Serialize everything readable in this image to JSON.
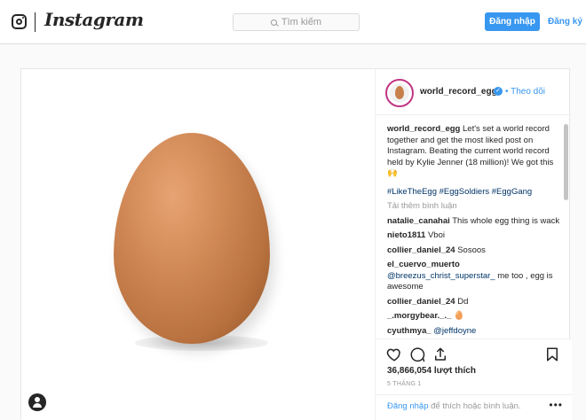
{
  "header": {
    "wordmark": "Instagram",
    "search_placeholder": "Tìm kiếm",
    "login_label": "Đăng nhập",
    "signup_label": "Đăng ký"
  },
  "post": {
    "username": "world_record_egg",
    "follow_label": "Theo dõi",
    "caption_user": "world_record_egg",
    "caption_text": "Let's set a world record together and get the most liked post on Instagram. Beating the current world record held by Kylie Jenner (18 million)! We got this 🙌",
    "hashtags": "#LikeTheEgg #EggSoldiers #EggGang",
    "load_more": "Tải thêm bình luận",
    "comments": [
      {
        "user": "natalie_canahai",
        "text": "This whole egg thing is wack"
      },
      {
        "user": "nieto1811",
        "text": "Vboi"
      },
      {
        "user": "collier_daniel_24",
        "text": "Sosoos"
      },
      {
        "user": "el_cuervo_muerto",
        "mention": "@breezus_christ_superstar_",
        "text": " me too , egg is awesome"
      },
      {
        "user": "collier_daniel_24",
        "text": "Dd"
      },
      {
        "user": "_.morgybear._._",
        "text": "🥚"
      },
      {
        "user": "cyuthmya_",
        "mention": "@jeffdoyne"
      }
    ],
    "likes": "36,866,054 lượt thích",
    "date": "5 THÁNG 1",
    "login_prompt_link": "Đăng nhập",
    "login_prompt_rest": " để thích hoặc bình luận.",
    "more_dots": "•••"
  },
  "colors": {
    "accent": "#3897f0",
    "egg": "#c7804c"
  },
  "icons": [
    "instagram-logo-icon",
    "search-icon",
    "verified-icon",
    "heart-icon",
    "comment-icon",
    "share-icon",
    "bookmark-icon",
    "user-icon"
  ]
}
